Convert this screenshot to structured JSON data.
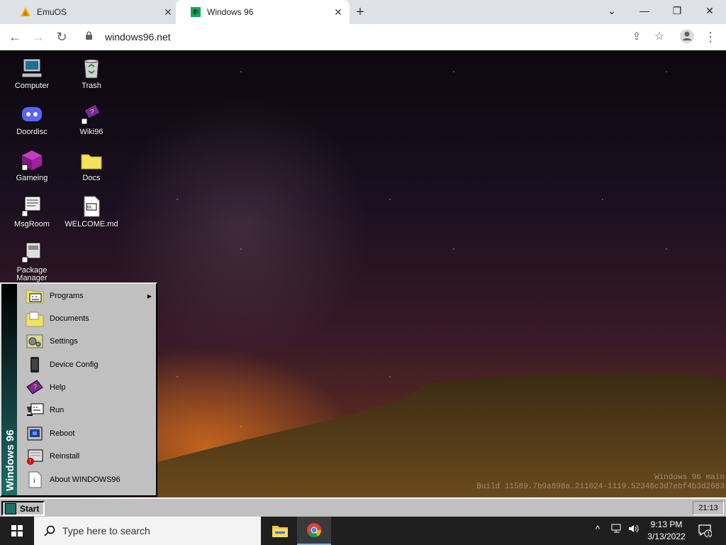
{
  "browser": {
    "tabs": [
      {
        "title": "EmuOS",
        "icon": "emuos-icon",
        "active": false
      },
      {
        "title": "Windows 96",
        "icon": "windows96-icon",
        "active": true
      }
    ],
    "new_tab": "+",
    "window_controls": [
      "minimize",
      "restore",
      "close"
    ],
    "url": "windows96.net"
  },
  "desktop": {
    "icons": [
      {
        "label": "Computer",
        "icon": "computer-icon"
      },
      {
        "label": "Trash",
        "icon": "trash-icon"
      },
      {
        "label": "Doordisc",
        "icon": "doordisc-icon"
      },
      {
        "label": "Wiki96",
        "icon": "wiki-book-icon"
      },
      {
        "label": "Gameing",
        "icon": "game-cube-icon"
      },
      {
        "label": "Docs",
        "icon": "folder-icon"
      },
      {
        "label": "MsgRoom",
        "icon": "msgroom-icon"
      },
      {
        "label": "WELCOME.md",
        "icon": "markdown-file-icon"
      },
      {
        "label": "Package Manager",
        "icon": "package-icon"
      }
    ],
    "build_line1": "Windows 96 main",
    "build_line2": "Build 11589.7b9a898a.211024-1119.52346c3d7ebf4b3d2683"
  },
  "start_menu": {
    "side_title": "Windows 96",
    "items": [
      {
        "label": "Programs",
        "icon": "programs-icon",
        "submenu": true
      },
      {
        "label": "Documents",
        "icon": "documents-folder-icon"
      },
      {
        "label": "Settings",
        "icon": "settings-icon"
      },
      {
        "label": "Device Config",
        "icon": "device-icon"
      },
      {
        "label": "Help",
        "icon": "help-book-icon"
      },
      {
        "label": "Run",
        "icon": "run-icon"
      },
      {
        "label": "Reboot",
        "icon": "reboot-icon"
      },
      {
        "label": "Reinstall",
        "icon": "reinstall-icon"
      },
      {
        "label": "About WINDOWS96",
        "icon": "about-icon"
      }
    ]
  },
  "w96_taskbar": {
    "start_label": "Start",
    "clock": "21:13"
  },
  "win_taskbar": {
    "search_placeholder": "Type here to search",
    "time": "9:13 PM",
    "date": "3/13/2022",
    "notification_count": "1"
  }
}
